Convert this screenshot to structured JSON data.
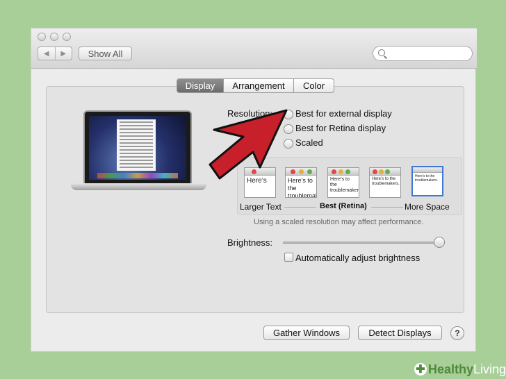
{
  "toolbar": {
    "back_icon": "back-arrow-icon",
    "forward_icon": "forward-arrow-icon",
    "back_glyph": "◀",
    "forward_glyph": "▶",
    "show_all_label": "Show All",
    "search_placeholder": ""
  },
  "tabs": [
    {
      "label": "Display",
      "active": true
    },
    {
      "label": "Arrangement",
      "active": false
    },
    {
      "label": "Color",
      "active": false
    }
  ],
  "resolution": {
    "label": "Resolution:",
    "options": [
      "Best for external display",
      "Best for Retina display",
      "Scaled"
    ],
    "scale_thumbnails": {
      "sample_text": "Here’s to the troublemakers.",
      "sample_short": "Here’s",
      "labels": {
        "left": "Larger Text",
        "middle": "Best (Retina)",
        "right": "More Space"
      },
      "note": "Using a scaled resolution may affect performance."
    }
  },
  "brightness": {
    "label": "Brightness:",
    "level": 1.0,
    "auto_label": "Automatically adjust brightness",
    "auto_checked": false
  },
  "buttons": {
    "gather_windows": "Gather Windows",
    "detect_displays": "Detect Displays",
    "help": "?"
  },
  "watermark": {
    "text_healthy": "Healthy",
    "text_living": " Living",
    "icon": "heart-plus-icon",
    "color_green": "#4e8a3a"
  },
  "colors": {
    "background": "#a9cf98",
    "arrow": "#c8202b",
    "selected_blue": "#3d79d2"
  }
}
